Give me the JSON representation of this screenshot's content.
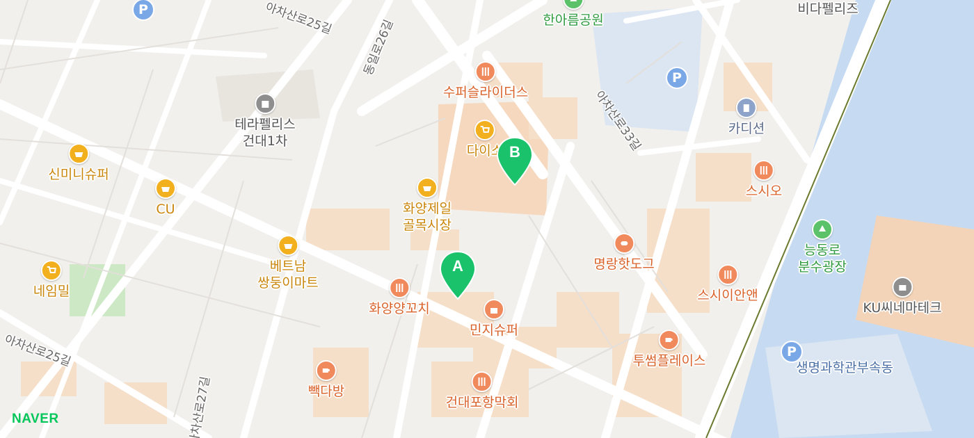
{
  "map": {
    "provider": "NAVER",
    "markers": [
      {
        "label": "A",
        "color": "#2ecc71"
      },
      {
        "label": "B",
        "color": "#2ecc71"
      }
    ],
    "pois": [
      {
        "name": "한아름공원",
        "icon": "park-icon",
        "kind": "park"
      },
      {
        "name": "비다펠리즈",
        "icon": "building-icon",
        "kind": "bldg"
      },
      {
        "name": "수퍼슬라이더스",
        "icon": "restaurant-icon",
        "kind": "food"
      },
      {
        "name": "테라펠리스\n건대1차",
        "icon": "building-icon",
        "kind": "bldg"
      },
      {
        "name": "다이소",
        "icon": "shopping-cart-icon",
        "kind": "shop"
      },
      {
        "name": "카디션",
        "icon": "office-icon",
        "kind": "off"
      },
      {
        "name": "신미니슈퍼",
        "icon": "basket-icon",
        "kind": "shop"
      },
      {
        "name": "CU",
        "icon": "basket-icon",
        "kind": "shop"
      },
      {
        "name": "화양제일\n골목시장",
        "icon": "basket-icon",
        "kind": "shop"
      },
      {
        "name": "스시오",
        "icon": "restaurant-icon",
        "kind": "food"
      },
      {
        "name": "능동로\n분수광장",
        "icon": "park-icon",
        "kind": "park"
      },
      {
        "name": "명랑핫도그",
        "icon": "burger-icon",
        "kind": "food"
      },
      {
        "name": "베트남\n쌍둥이마트",
        "icon": "basket-icon",
        "kind": "shop"
      },
      {
        "name": "네임밀",
        "icon": "shopping-cart-icon",
        "kind": "shop"
      },
      {
        "name": "화양양꼬치",
        "icon": "restaurant-icon",
        "kind": "food"
      },
      {
        "name": "민지슈퍼",
        "icon": "store-icon",
        "kind": "food"
      },
      {
        "name": "스시이안앤",
        "icon": "restaurant-icon",
        "kind": "food"
      },
      {
        "name": "KU씨네마테크",
        "icon": "cinema-icon",
        "kind": "bldg"
      },
      {
        "name": "투썸플레이스",
        "icon": "cafe-icon",
        "kind": "food"
      },
      {
        "name": "빽다방",
        "icon": "cafe-icon",
        "kind": "food"
      },
      {
        "name": "건대포항막회",
        "icon": "restaurant-icon",
        "kind": "food"
      },
      {
        "name": "생명과학관부속동",
        "icon": "",
        "kind": "blue"
      }
    ],
    "parking_label": "P",
    "roads": [
      "아차산로25길",
      "동일로26길",
      "아차산로33길",
      "아차산로25길",
      "아차산로27길"
    ]
  }
}
